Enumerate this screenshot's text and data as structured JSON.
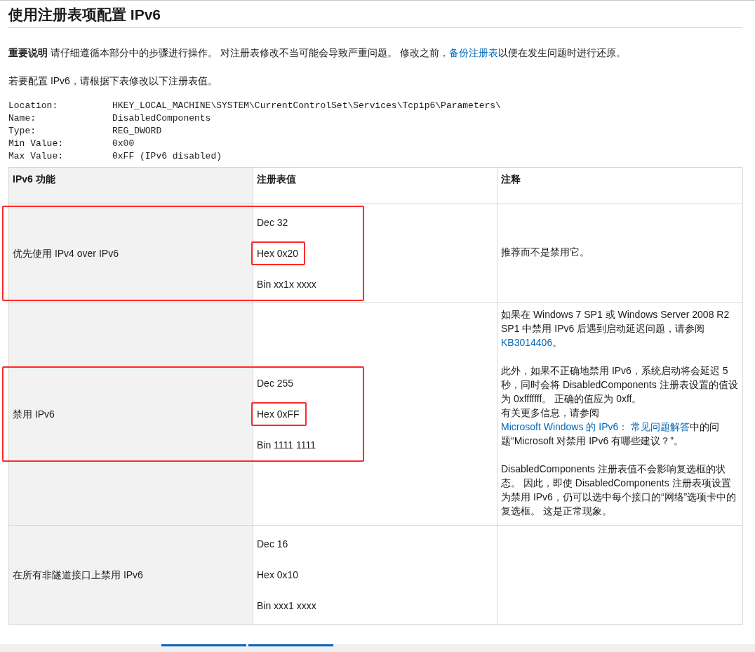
{
  "title": "使用注册表项配置 IPv6",
  "intro": [
    {
      "kind": "bold",
      "text": "重要说明"
    },
    {
      "kind": "text",
      "text": " 请仔细遵循本部分中的步骤进行操作。 对注册表修改不当可能会导致严重问题。 修改之前，"
    },
    {
      "kind": "link",
      "text": "备份注册表"
    },
    {
      "kind": "text",
      "text": "以便在发生问题时进行还原。"
    }
  ],
  "lead": "若要配置 IPv6，请根据下表修改以下注册表值。",
  "registry": [
    {
      "key": "Location:",
      "value": "HKEY_LOCAL_MACHINE\\SYSTEM\\CurrentControlSet\\Services\\Tcpip6\\Parameters\\"
    },
    {
      "key": "Name:",
      "value": "DisabledComponents"
    },
    {
      "key": "Type:",
      "value": "REG_DWORD"
    },
    {
      "key": "Min Value:",
      "value": "0x00"
    },
    {
      "key": "Max Value:",
      "value": "0xFF (IPv6 disabled)"
    }
  ],
  "table": {
    "columns": [
      "IPv6 功能",
      "注册表值",
      "注释"
    ],
    "rows": [
      {
        "feature": "优先使用 IPv4 over IPv6",
        "highlighted": true,
        "values": [
          {
            "text": "Dec 32",
            "highlighted": false
          },
          {
            "text": "Hex 0x20",
            "highlighted": true
          },
          {
            "text": "Bin xx1x xxxx",
            "highlighted": false
          }
        ],
        "notes": [
          {
            "blocks": [
              {
                "segments": [
                  {
                    "kind": "text",
                    "text": "推荐而不是禁用它。"
                  }
                ]
              }
            ]
          }
        ]
      },
      {
        "feature": "禁用 IPv6",
        "highlighted": true,
        "values": [
          {
            "text": "Dec 255",
            "highlighted": false
          },
          {
            "text": "Hex 0xFF",
            "highlighted": true
          },
          {
            "text": "Bin 1111 1111",
            "highlighted": false
          }
        ],
        "notes": [
          {
            "blocks": [
              {
                "segments": [
                  {
                    "kind": "text",
                    "text": "如果在 Windows 7 SP1 或 Windows Server 2008 R2 SP1 中禁用 IPv6 后遇到启动延迟问题，请参阅 "
                  },
                  {
                    "kind": "link",
                    "text": "KB3014406"
                  },
                  {
                    "kind": "text",
                    "text": "。"
                  }
                ]
              }
            ]
          },
          {
            "blocks": [
              {
                "segments": [
                  {
                    "kind": "text",
                    "text": "此外，如果不正确地禁用 IPv6，系统启动将会延迟 5 秒，同时会将 DisabledComponents 注册表设置的值设为 0xfffffff。 正确的值应为 0xff。"
                  }
                ]
              },
              {
                "segments": [
                  {
                    "kind": "text",
                    "text": "有关更多信息，请参阅 "
                  },
                  {
                    "kind": "link",
                    "text": "Microsoft Windows 的 IPv6： 常见问题解答"
                  },
                  {
                    "kind": "text",
                    "text": "中的问题“Microsoft 对禁用 IPv6 有哪些建议？”。"
                  }
                ]
              }
            ]
          },
          {
            "blocks": [
              {
                "segments": [
                  {
                    "kind": "text",
                    "text": "DisabledComponents 注册表值不会影响复选框的状态。 因此，即使 DisabledComponents 注册表项设置为禁用 IPv6，仍可以选中每个接口的“网络”选项卡中的复选框。 这是正常现象。"
                  }
                ]
              }
            ]
          }
        ]
      },
      {
        "feature": "在所有非隧道接口上禁用 IPv6",
        "highlighted": false,
        "values": [
          {
            "text": "Dec 16",
            "highlighted": false
          },
          {
            "text": "Hex 0x10",
            "highlighted": false
          },
          {
            "text": "Bin xxx1 xxxx",
            "highlighted": false
          }
        ],
        "notes": []
      }
    ]
  }
}
